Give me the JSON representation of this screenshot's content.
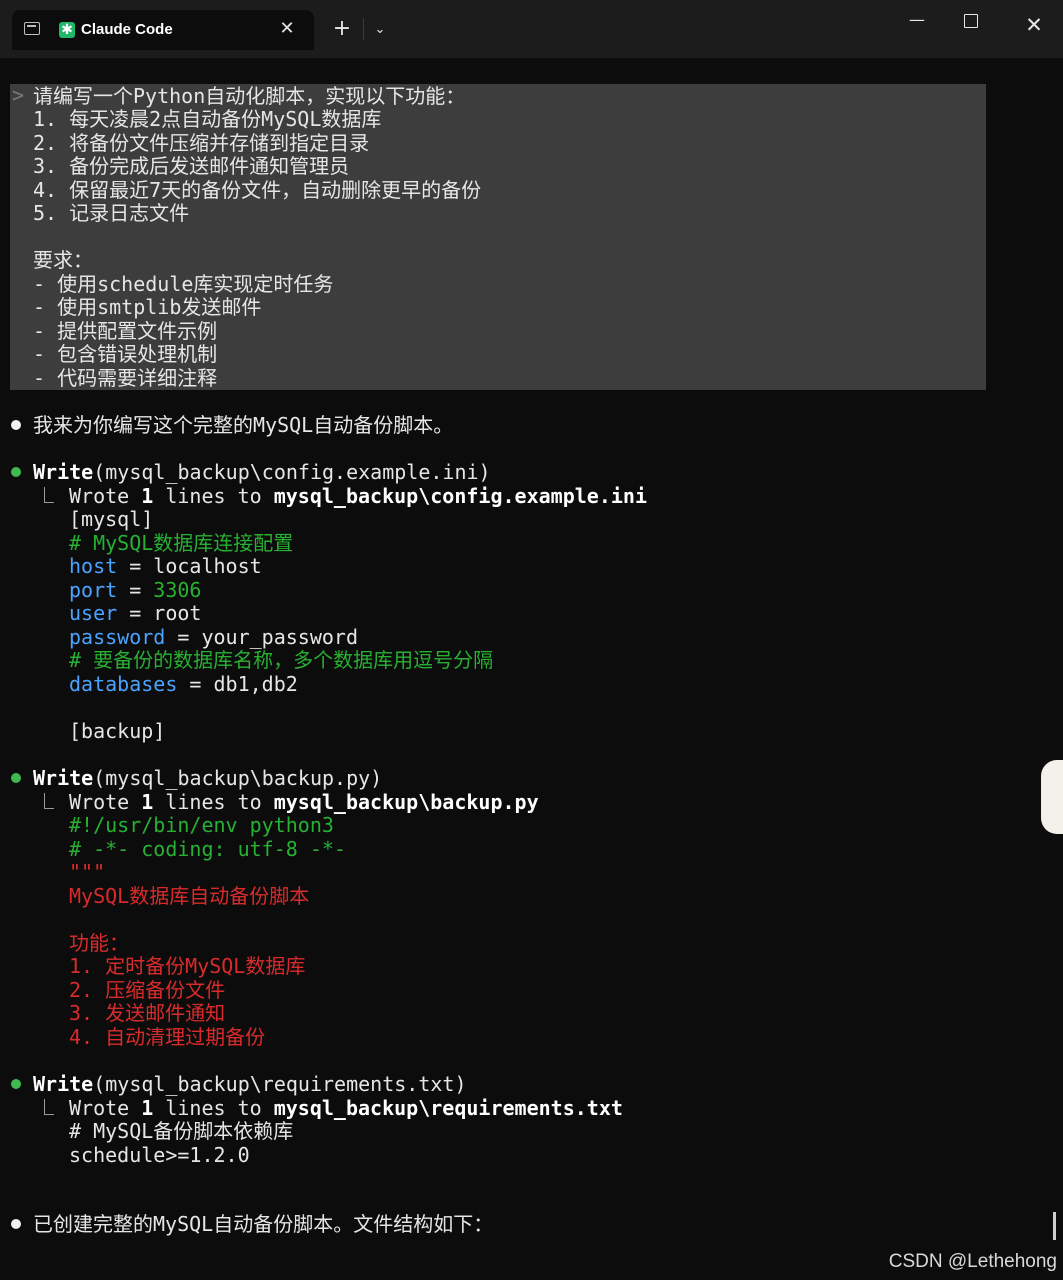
{
  "window": {
    "tab_title": "Claude Code",
    "close_tab": "✕",
    "new_tab": "+",
    "dropdown": "⌄",
    "minimize": "—",
    "close": "✕"
  },
  "prompt": {
    "caret": ">",
    "lines": [
      "请编写一个Python自动化脚本，实现以下功能：",
      "1. 每天凌晨2点自动备份MySQL数据库",
      "2. 将备份文件压缩并存储到指定目录",
      "3. 备份完成后发送邮件通知管理员",
      "4. 保留最近7天的备份文件，自动删除更早的备份",
      "5. 记录日志文件",
      "",
      "要求：",
      "- 使用schedule库实现定时任务",
      "- 使用smtplib发送邮件",
      "- 提供配置文件示例",
      "- 包含错误处理机制",
      "- 代码需要详细注释"
    ]
  },
  "response_intro": "我来为你编写这个完整的MySQL自动备份脚本。",
  "write1": {
    "tool": "Write",
    "arg": "(mysql_backup\\config.example.ini)",
    "result_prefix": "Wrote ",
    "result_count": "1",
    "result_mid": " lines to ",
    "result_path": "mysql_backup\\config.example.ini",
    "l1": "[mysql]",
    "l2": "# MySQL数据库连接配置",
    "l3_key": "host",
    "l3_rest": " = localhost",
    "l4_key": "port",
    "l4_eq": " = ",
    "l4_val": "3306",
    "l5_key": "user",
    "l5_rest": " = root",
    "l6_key": "password",
    "l6_rest": " = your_password",
    "l7": "# 要备份的数据库名称，多个数据库用逗号分隔",
    "l8_key": "databases",
    "l8_rest": " = db1,db2",
    "l9": "[backup]"
  },
  "write2": {
    "tool": "Write",
    "arg": "(mysql_backup\\backup.py)",
    "result_prefix": "Wrote ",
    "result_count": "1",
    "result_mid": " lines to ",
    "result_path": "mysql_backup\\backup.py",
    "l1": "#!/usr/bin/env python3",
    "l2": "# -*- coding: utf-8 -*-",
    "l3": "\"\"\"",
    "l4": "MySQL数据库自动备份脚本",
    "l5": "功能：",
    "l6": "1. 定时备份MySQL数据库",
    "l7": "2. 压缩备份文件",
    "l8": "3. 发送邮件通知",
    "l9": "4. 自动清理过期备份"
  },
  "write3": {
    "tool": "Write",
    "arg": "(mysql_backup\\requirements.txt)",
    "result_prefix": "Wrote ",
    "result_count": "1",
    "result_mid": " lines to ",
    "result_path": "mysql_backup\\requirements.txt",
    "l1": "# MySQL备份脚本依赖库",
    "l2": "schedule>=1.2.0"
  },
  "final_message": "已创建完整的MySQL自动备份脚本。文件结构如下：",
  "watermark": "CSDN @Lethehong"
}
